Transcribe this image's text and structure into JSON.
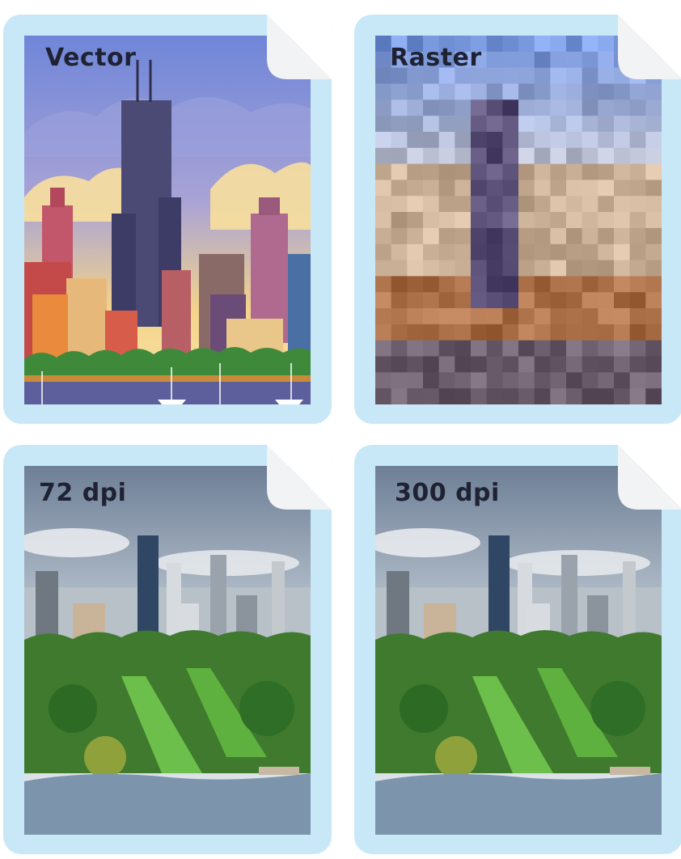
{
  "cards": [
    {
      "label": "Vector"
    },
    {
      "label": "Raster"
    },
    {
      "label": "72 dpi"
    },
    {
      "label": "300 dpi"
    }
  ],
  "colors": {
    "frame": "#c9e8f7",
    "fold": "#f2f3f5",
    "label": "#1e2233"
  }
}
